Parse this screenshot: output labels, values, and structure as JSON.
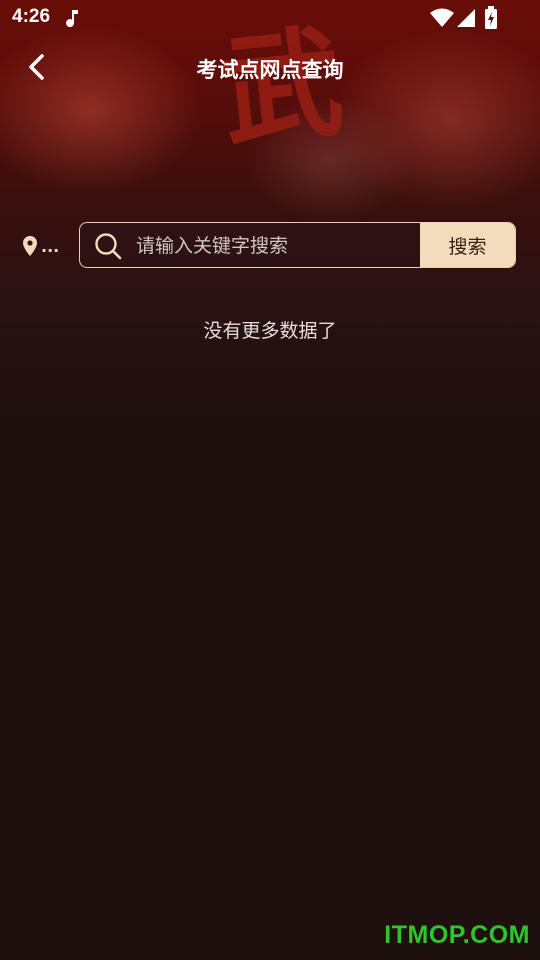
{
  "status_bar": {
    "time": "4:26"
  },
  "header": {
    "title": "考试点网点查询"
  },
  "hero": {
    "character": "武"
  },
  "location": {
    "label": "..."
  },
  "search": {
    "placeholder": "请输入关键字搜索",
    "value": "",
    "button_label": "搜索"
  },
  "list": {
    "empty_message": "没有更多数据了"
  },
  "watermark": {
    "text": "ITMOP.COM"
  },
  "colors": {
    "accent": "#f3dcbb",
    "background": "#1f1010",
    "header_red": "#6a0d08",
    "watermark_green": "#2fc52a"
  },
  "icons": {
    "music": "music-note-icon",
    "wifi": "wifi-icon",
    "signal": "signal-icon",
    "battery": "battery-charging-icon",
    "back": "chevron-left-icon",
    "location": "location-pin-icon",
    "search": "search-icon"
  }
}
